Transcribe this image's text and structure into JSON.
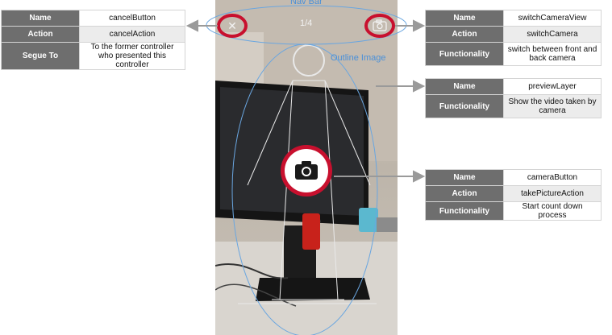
{
  "labels": {
    "nav_bar": "Nav Bar",
    "outline_image": "Outline Image"
  },
  "nav": {
    "counter": "1/4"
  },
  "tables": {
    "cancel": [
      {
        "key": "Name",
        "value": "cancelButton"
      },
      {
        "key": "Action",
        "value": "cancelAction"
      },
      {
        "key": "Segue To",
        "value": "To the former controller who presented this controller"
      }
    ],
    "switch": [
      {
        "key": "Name",
        "value": "switchCameraView"
      },
      {
        "key": "Action",
        "value": "switchCamera"
      },
      {
        "key": "Functionality",
        "value": "switch between front and back camera"
      }
    ],
    "preview": [
      {
        "key": "Name",
        "value": "previewLayer"
      },
      {
        "key": "Functionality",
        "value": "Show the video taken by camera"
      }
    ],
    "camera": [
      {
        "key": "Name",
        "value": "cameraButton"
      },
      {
        "key": "Action",
        "value": "takePictureAction"
      },
      {
        "key": "Functionality",
        "value": "Start count down process"
      }
    ]
  },
  "colors": {
    "highlight": "#c8102e",
    "annotation": "#4a90d9",
    "header_cell": "#6e6e6e"
  }
}
